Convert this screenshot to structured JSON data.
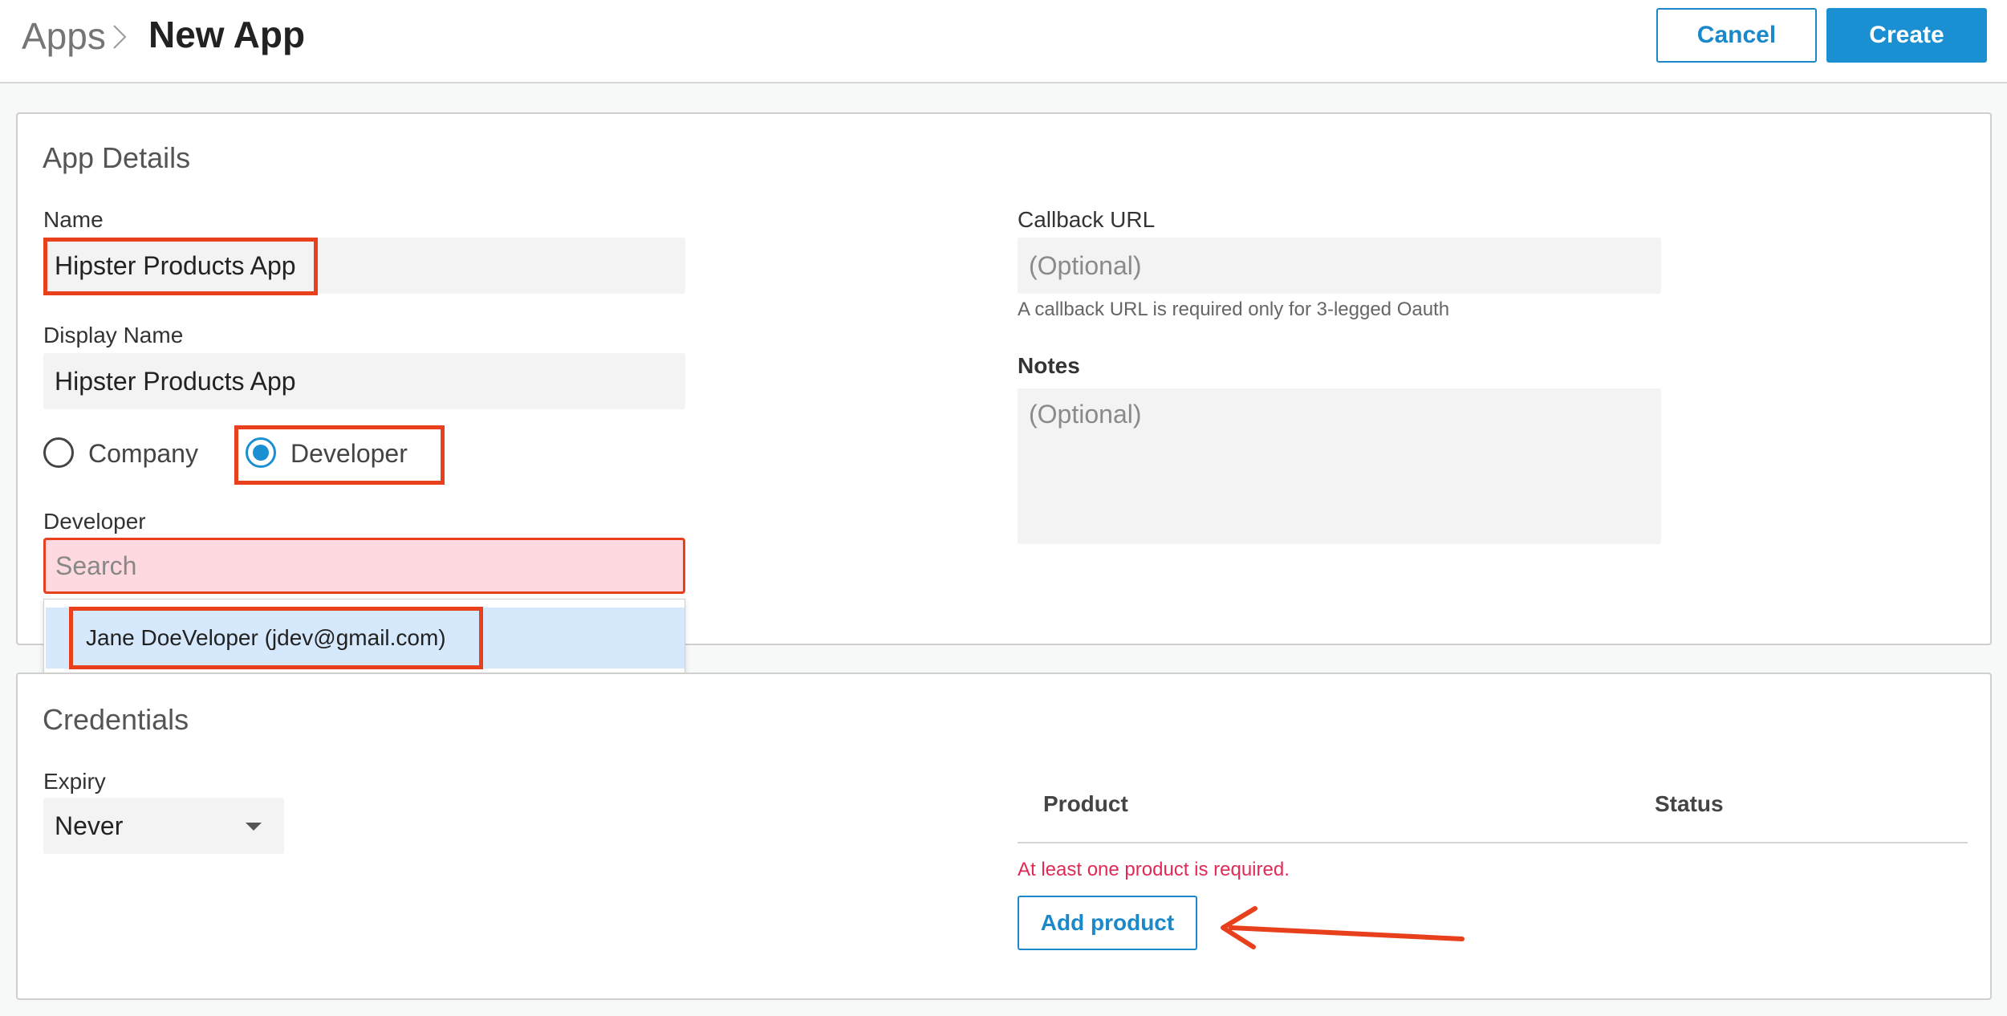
{
  "header": {
    "breadcrumb": "Apps",
    "title": "New App",
    "cancel_label": "Cancel",
    "create_label": "Create"
  },
  "details": {
    "section_title": "App Details",
    "name_label": "Name",
    "name_value": "Hipster Products App",
    "display_name_label": "Display Name",
    "display_name_value": "Hipster Products App",
    "owner_options": [
      {
        "label": "Company",
        "selected": false
      },
      {
        "label": "Developer",
        "selected": true
      }
    ],
    "developer_label": "Developer",
    "developer_search_placeholder": "Search",
    "developer_suggestion": "Jane DoeVeloper (jdev@gmail.com)",
    "callback_label": "Callback URL",
    "callback_placeholder": "(Optional)",
    "callback_hint": "A callback URL is required only for 3-legged Oauth",
    "notes_label": "Notes",
    "notes_placeholder": "(Optional)"
  },
  "credentials": {
    "section_title": "Credentials",
    "expiry_label": "Expiry",
    "expiry_value": "Never",
    "table_headers": [
      "Product",
      "Status"
    ],
    "error_text": "At least one product is required.",
    "add_product_label": "Add product"
  },
  "colors": {
    "accent": "#1a8fd1",
    "annotation": "#e8401c",
    "error": "#e02a55"
  }
}
